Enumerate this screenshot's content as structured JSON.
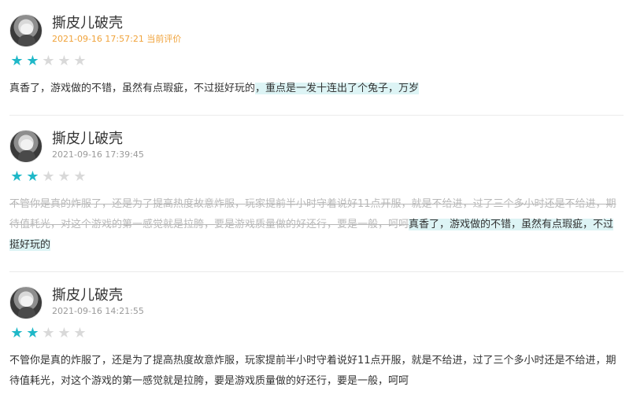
{
  "reviews": [
    {
      "username": "撕皮儿破壳",
      "datetime": "2021-09-16 17:57:21",
      "tag": "当前评价",
      "rating": 2,
      "max_rating": 5,
      "content_plain": "真香了，游戏做的不错，虽然有点瑕疵，不过挺好玩的",
      "content_highlight": "，重点是一发十连出了个兔子，万岁"
    },
    {
      "username": "撕皮儿破壳",
      "datetime": "2021-09-16 17:39:45",
      "rating": 2,
      "max_rating": 5,
      "content_struck": "不管你是真的炸服了，还是为了提高热度故意炸服，玩家提前半小时守着说好11点开服，就是不给进，过了三个多小时还是不给进，期待值耗光，对这个游戏的第一感觉就是拉胯，要是游戏质量做的好还行，要是一般，呵呵",
      "content_highlight": "真香了，游戏做的不错，虽然有点瑕疵，不过挺好玩的"
    },
    {
      "username": "撕皮儿破壳",
      "datetime": "2021-09-16 14:21:55",
      "rating": 2,
      "max_rating": 5,
      "content_plain": "不管你是真的炸服了，还是为了提高热度故意炸服，玩家提前半小时守着说好11点开服，就是不给进，过了三个多小时还是不给进，期待值耗光，对这个游戏的第一感觉就是拉胯，要是游戏质量做的好还行，要是一般，呵呵"
    }
  ],
  "colors": {
    "star_filled": "#1fb8c8",
    "star_empty": "#d9d9d9",
    "current_tag": "#f0a33b",
    "highlight_bg": "#ddf4f5"
  },
  "icons": {
    "star": "star-icon"
  }
}
